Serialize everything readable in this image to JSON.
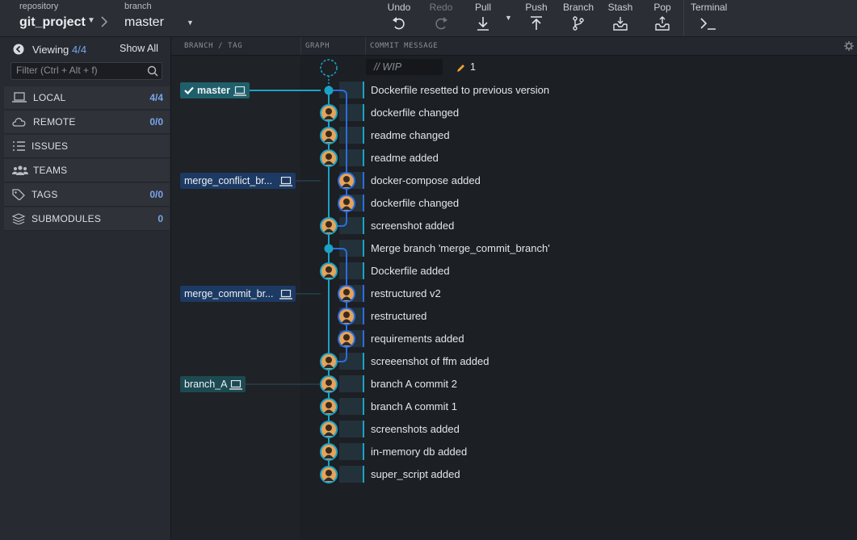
{
  "toolbar": {
    "repo_caption": "repository",
    "repo_name": "git_project",
    "branch_caption": "branch",
    "branch_name": "master",
    "buttons": {
      "undo": "Undo",
      "redo": "Redo",
      "pull": "Pull",
      "push": "Push",
      "branch": "Branch",
      "stash": "Stash",
      "pop": "Pop",
      "terminal": "Terminal"
    }
  },
  "left_panel": {
    "viewing_label": "Viewing",
    "viewing_count": "4/4",
    "show_all": "Show All",
    "filter_placeholder": "Filter (Ctrl + Alt + f)",
    "sections": [
      {
        "label": "LOCAL",
        "count": "4/4",
        "icon": "laptop-icon"
      },
      {
        "label": "REMOTE",
        "count": "0/0",
        "icon": "cloud-icon"
      },
      {
        "label": "ISSUES",
        "count": "",
        "icon": "list-icon"
      },
      {
        "label": "TEAMS",
        "count": "",
        "icon": "people-icon"
      },
      {
        "label": "TAGS",
        "count": "0/0",
        "icon": "tag-icon"
      },
      {
        "label": "SUBMODULES",
        "count": "0",
        "icon": "layers-icon"
      }
    ]
  },
  "graph": {
    "columns": {
      "branch_tag": "BRANCH / TAG",
      "graph": "GRAPH",
      "commit_message": "COMMIT MESSAGE"
    },
    "wip": {
      "label": "// WIP",
      "count": "1"
    },
    "refs": [
      {
        "label": "master",
        "row": 0,
        "checked": true
      },
      {
        "label": "merge_conflict_br...",
        "row": 4,
        "checked": false
      },
      {
        "label": "merge_commit_br...",
        "row": 9,
        "checked": false
      },
      {
        "label": "branch_A",
        "row": 13,
        "checked": false
      }
    ],
    "commits": [
      {
        "message": "Dockerfile resetted to previous version",
        "lane": 0,
        "type": "merge"
      },
      {
        "message": "dockerfile changed",
        "lane": 0,
        "type": "avatar"
      },
      {
        "message": "readme changed",
        "lane": 0,
        "type": "avatar"
      },
      {
        "message": "readme added",
        "lane": 0,
        "type": "avatar"
      },
      {
        "message": "docker-compose added",
        "lane": 1,
        "type": "avatar"
      },
      {
        "message": "dockerfile changed",
        "lane": 1,
        "type": "avatar"
      },
      {
        "message": "screenshot added",
        "lane": 0,
        "type": "avatar"
      },
      {
        "message": "Merge branch 'merge_commit_branch'",
        "lane": 0,
        "type": "merge"
      },
      {
        "message": "Dockerfile added",
        "lane": 0,
        "type": "avatar"
      },
      {
        "message": "restructured v2",
        "lane": 1,
        "type": "avatar"
      },
      {
        "message": "restructured",
        "lane": 1,
        "type": "avatar"
      },
      {
        "message": "requirements added",
        "lane": 1,
        "type": "avatar"
      },
      {
        "message": "screeenshot of ffm added",
        "lane": 0,
        "type": "avatar"
      },
      {
        "message": "branch A commit 2",
        "lane": 0,
        "type": "avatar"
      },
      {
        "message": "branch A commit 1",
        "lane": 0,
        "type": "avatar"
      },
      {
        "message": "screenshots added",
        "lane": 0,
        "type": "avatar"
      },
      {
        "message": "in-memory db added",
        "lane": 0,
        "type": "avatar"
      },
      {
        "message": "super_script added",
        "lane": 0,
        "type": "avatar"
      }
    ]
  },
  "colors": {
    "lane0": "#1aa3c7",
    "lane1": "#2a6de0",
    "ref_master": "#1f5f6b",
    "ref_local": "#1c3a63",
    "ref_branchA": "#1c4a52",
    "accent_count": "#7aa6ef"
  }
}
